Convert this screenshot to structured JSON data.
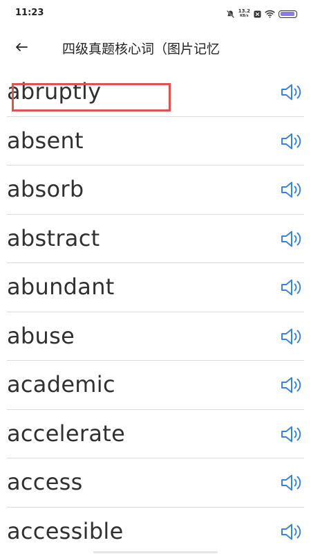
{
  "status_bar": {
    "time": "11:23",
    "net_speed_value": "13.2",
    "net_speed_unit": "KB/s",
    "battery_level": 0.95,
    "battery_color": "#8a7be0"
  },
  "header": {
    "back_icon": "arrow-left-icon",
    "title": "四级真题核心词（图片记忆"
  },
  "words": [
    "abruptly",
    "absent",
    "absorb",
    "abstract",
    "abundant",
    "abuse",
    "academic",
    "accelerate",
    "access",
    "accessible"
  ],
  "speaker_icon": "speaker-icon",
  "colors": {
    "accent_icon": "#3a82d8",
    "highlight_border": "#e0524d",
    "divider": "#dcdcdc"
  }
}
